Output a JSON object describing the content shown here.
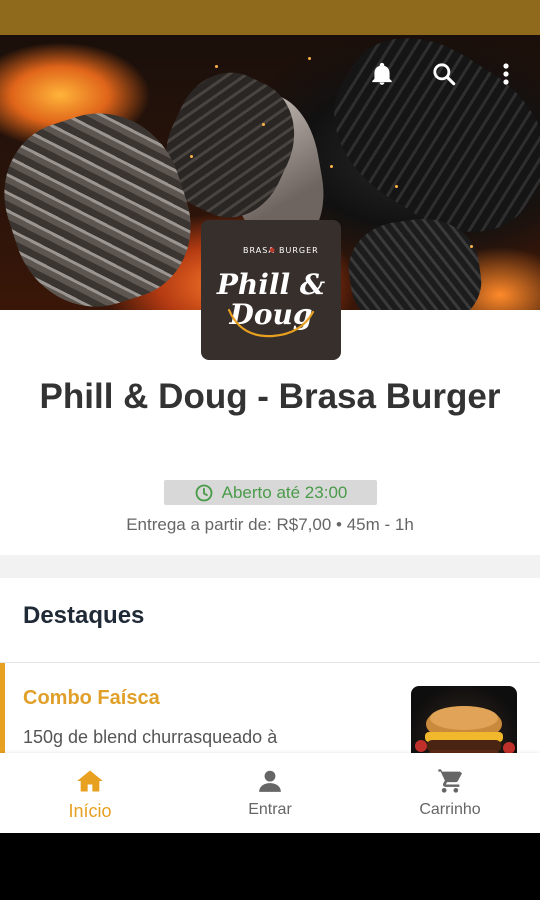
{
  "colors": {
    "status_bar": "#8f6a1c",
    "accent": "#e8a020",
    "open_green": "#4a9b4a",
    "logo_bg": "#372f2c"
  },
  "header": {
    "actions": [
      {
        "icon": "bell-icon"
      },
      {
        "icon": "search-icon"
      },
      {
        "icon": "more-vertical-icon"
      }
    ]
  },
  "logo": {
    "top_text": "BRASA",
    "top_text_right": "BURGER",
    "line1": "Phill &",
    "line2": "Doug"
  },
  "store": {
    "name": "Phill & Doug - Brasa Burger",
    "open_status": "Aberto até 23:00",
    "delivery_info": "Entrega a partir de: R$7,00 • 45m - 1h"
  },
  "section": {
    "title": "Destaques"
  },
  "products": [
    {
      "name": "Combo Faísca",
      "description": "150g de blend churrasqueado à"
    }
  ],
  "bottom_nav": [
    {
      "label": "Início",
      "icon": "home-icon",
      "active": true
    },
    {
      "label": "Entrar",
      "icon": "person-icon",
      "active": false
    },
    {
      "label": "Carrinho",
      "icon": "cart-icon",
      "active": false
    }
  ]
}
